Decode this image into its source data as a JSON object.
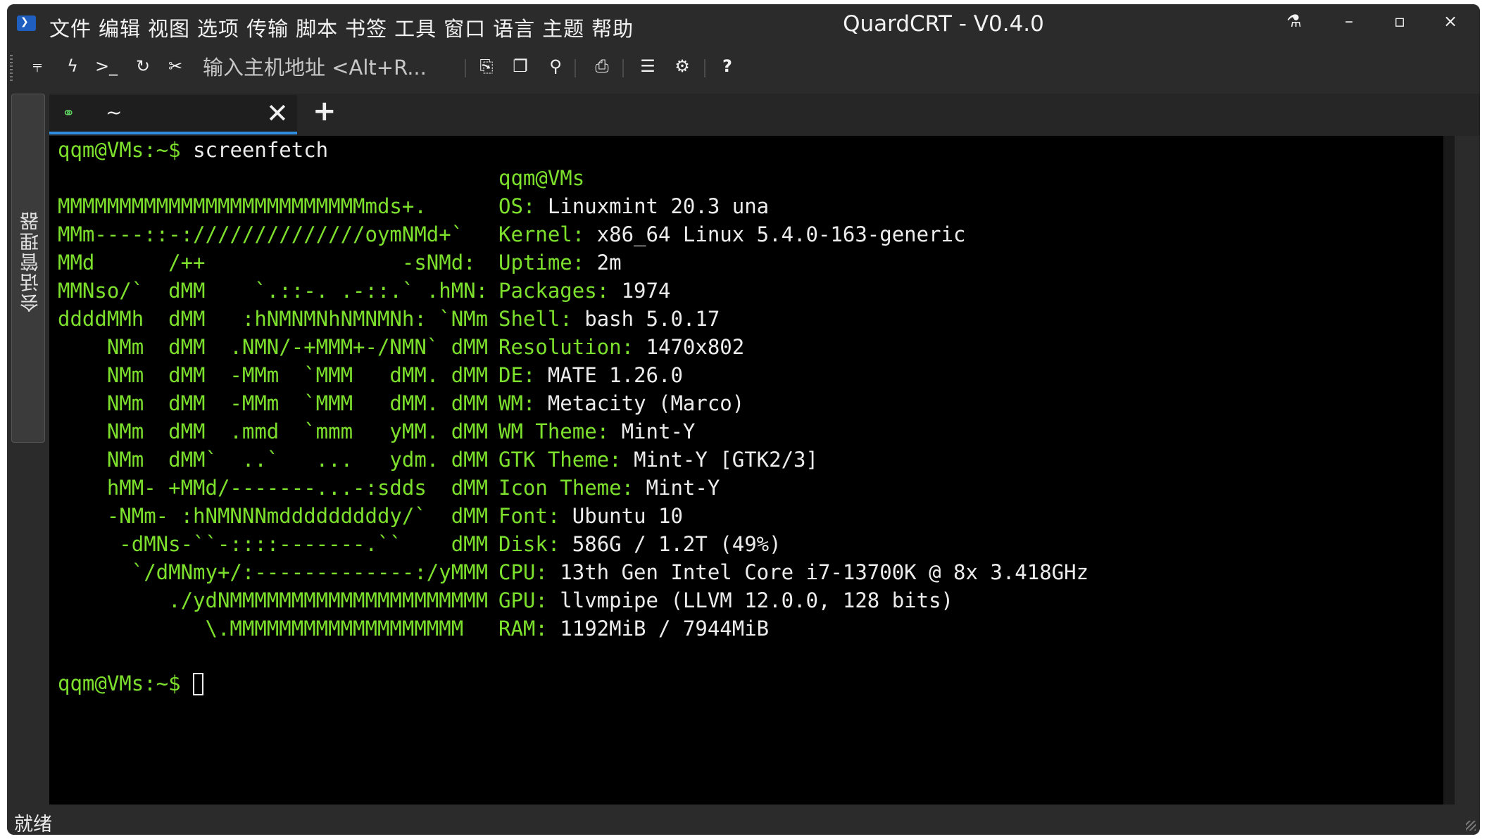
{
  "app": {
    "window_title": "QuardCRT - V0.4.0"
  },
  "menu": [
    "文件",
    "编辑",
    "视图",
    "选项",
    "传输",
    "脚本",
    "书签",
    "工具",
    "窗口",
    "语言",
    "主题",
    "帮助"
  ],
  "window_controls": {
    "flask": "⚗",
    "minimize": "–",
    "maximize": "▫",
    "close": "×"
  },
  "toolbar": {
    "host_placeholder": "输入主机地址 <Alt+R...",
    "icons": [
      "network-icon",
      "lightning-icon",
      "terminal-prompt-icon",
      "refresh-icon",
      "disconnect-icon",
      "copy-icon",
      "paste-icon",
      "search-icon",
      "print-icon",
      "settings-sliders-icon",
      "gear-icon",
      "help-icon"
    ]
  },
  "side_panel": {
    "label": "会话管理器"
  },
  "tabs": [
    {
      "label": "~",
      "active": true
    }
  ],
  "terminal": {
    "prompt": "qqm@VMs:~$",
    "command": " screenfetch",
    "logo": [
      "MMMMMMMMMMMMMMMMMMMMMMMMMmds+.",
      "MMm----::-://////////////oymNMd+`",
      "MMd      /++                -sNMd:",
      "MMNso/`  dMM    `.::-. .-::.` .hMN:",
      "ddddMMh  dMM   :hNMNMNhNMNMNh: `NMm",
      "    NMm  dMM  .NMN/-+MMM+-/NMN` dMM",
      "    NMm  dMM  -MMm  `MMM   dMM. dMM",
      "    NMm  dMM  -MMm  `MMM   dMM. dMM",
      "    NMm  dMM  .mmd  `mmm   yMM. dMM",
      "    NMm  dMM`  ..`   ...   ydm. dMM",
      "    hMM- +MMd/-------...-:sdds  dMM",
      "    -NMm- :hNMNNNmdddddddddy/`  dMM",
      "     -dMNs-``-::::-------.``    dMM",
      "      `/dMNmy+/:-------------:/yMMM",
      "         ./ydNMMMMMMMMMMMMMMMMMMMMM",
      "            \\.MMMMMMMMMMMMMMMMMMM"
    ],
    "user_host": "qqm@VMs",
    "info": [
      {
        "key": "OS:",
        "value": " Linuxmint 20.3 una"
      },
      {
        "key": "Kernel:",
        "value": " x86_64 Linux 5.4.0-163-generic"
      },
      {
        "key": "Uptime:",
        "value": " 2m"
      },
      {
        "key": "Packages:",
        "value": " 1974"
      },
      {
        "key": "Shell:",
        "value": " bash 5.0.17"
      },
      {
        "key": "Resolution:",
        "value": " 1470x802"
      },
      {
        "key": "DE:",
        "value": " MATE 1.26.0"
      },
      {
        "key": "WM:",
        "value": " Metacity (Marco)"
      },
      {
        "key": "WM Theme:",
        "value": " Mint-Y"
      },
      {
        "key": "GTK Theme:",
        "value": " Mint-Y [GTK2/3]"
      },
      {
        "key": "Icon Theme:",
        "value": " Mint-Y"
      },
      {
        "key": "Font:",
        "value": " Ubuntu 10"
      },
      {
        "key": "Disk:",
        "value": " 586G / 1.2T (49%)"
      },
      {
        "key": "CPU:",
        "value": " 13th Gen Intel Core i7-13700K @ 8x 3.418GHz"
      },
      {
        "key": "GPU:",
        "value": " llvmpipe (LLVM 12.0.0, 128 bits)"
      },
      {
        "key": "RAM:",
        "value": " 1192MiB / 7944MiB"
      }
    ]
  },
  "status": {
    "text": "就绪"
  },
  "colors": {
    "accent_green": "#7ce02c",
    "tab_underline": "#2f8ee0",
    "terminal_bg": "#000000"
  }
}
